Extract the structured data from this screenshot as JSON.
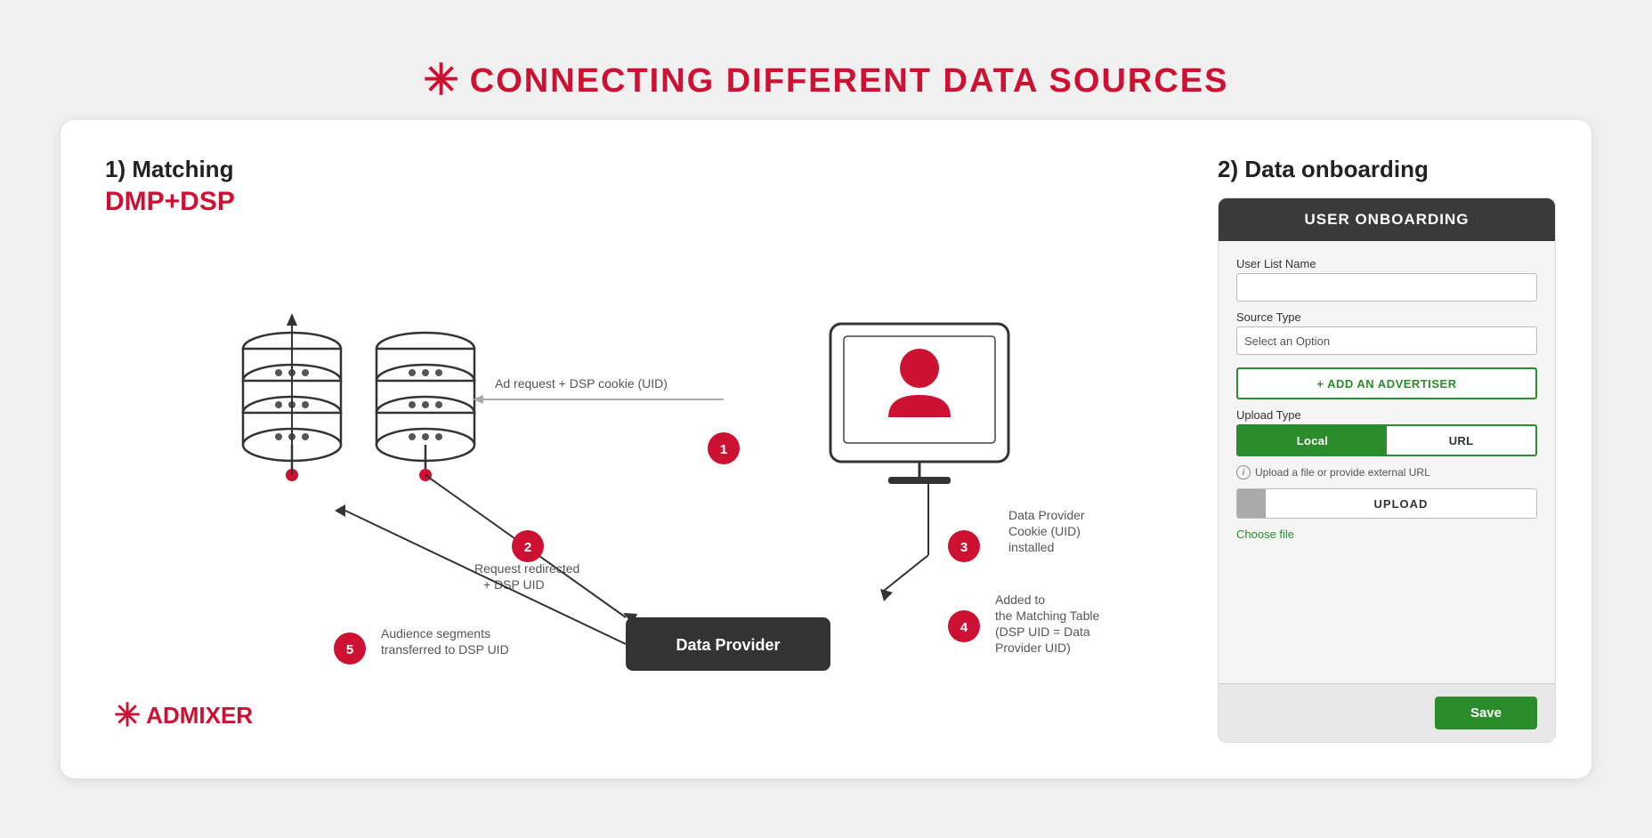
{
  "page": {
    "title": "CONNECTING DIFFERENT DATA SOURCES",
    "asterisk": "✳"
  },
  "left_section": {
    "label": "1) Matching",
    "sublabel": "DMP+DSP",
    "steps": [
      {
        "number": "1",
        "label": "Ad request + DSP cookie (UID)"
      },
      {
        "number": "2",
        "label": "Request redirected + DSP UID"
      },
      {
        "number": "3",
        "label": "Data Provider Cookie (UID) installed"
      },
      {
        "number": "4",
        "label": "Added to the Matching Table (DSP UID = Data Provider UID)"
      },
      {
        "number": "5",
        "label": "Audience segments transferred to DSP UID"
      }
    ],
    "data_provider_label": "Data Provider"
  },
  "logo": {
    "asterisk": "✳",
    "text_red": "AD",
    "text_black": "MIXER"
  },
  "right_section": {
    "label": "2) Data onboarding",
    "panel": {
      "header": "USER ONBOARDING",
      "user_list_name_label": "User List Name",
      "user_list_name_placeholder": "",
      "source_type_label": "Source Type",
      "source_type_placeholder": "Select an Option",
      "add_advertiser_label": "+ ADD AN ADVERTISER",
      "upload_type_label": "Upload Type",
      "upload_local_label": "Local",
      "upload_url_label": "URL",
      "upload_info_text": "Upload a file or provide external URL",
      "upload_button_label": "UPLOAD",
      "choose_file_label": "Choose file",
      "save_label": "Save"
    }
  }
}
